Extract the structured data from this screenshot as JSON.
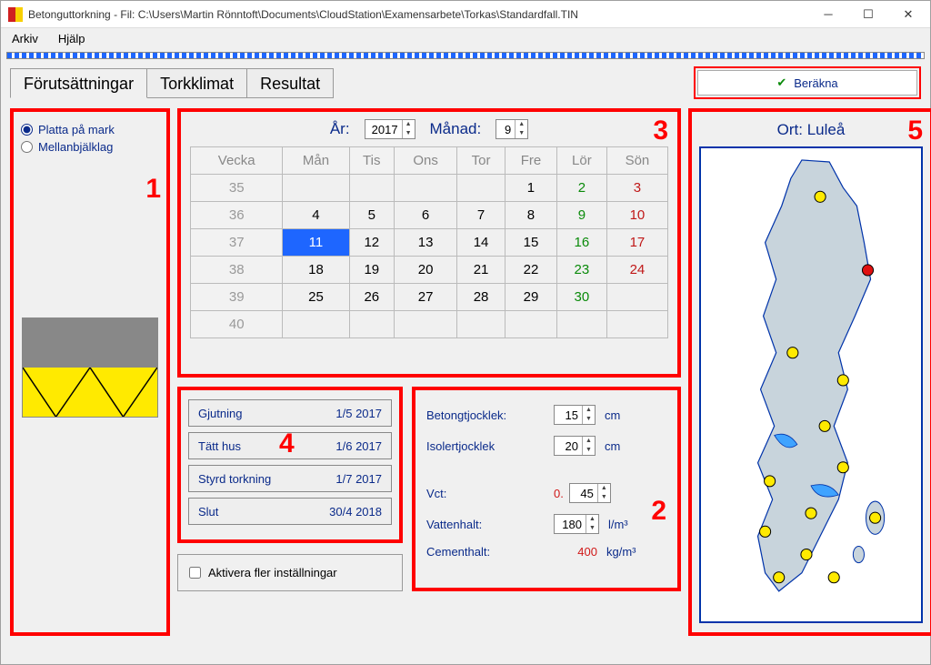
{
  "window": {
    "title": "Betonguttorkning  -  Fil: C:\\Users\\Martin Rönntoft\\Documents\\CloudStation\\Examensarbete\\Torkas\\Standardfall.TIN"
  },
  "menu": {
    "arkiv": "Arkiv",
    "hjalp": "Hjälp"
  },
  "tabs": {
    "t1": "Förutsättningar",
    "t2": "Torkklimat",
    "t3": "Resultat"
  },
  "berakna": "Beräkna",
  "annotations": {
    "n1": "1",
    "n2": "2",
    "n3": "3",
    "n4": "4",
    "n5": "5"
  },
  "sidebar": {
    "opt1": "Platta på mark",
    "opt2": "Mellanbjälklag"
  },
  "cal": {
    "year_label": "År:",
    "month_label": "Månad:",
    "year": "2017",
    "month": "9",
    "headers": {
      "vecka": "Vecka",
      "man": "Mån",
      "tis": "Tis",
      "ons": "Ons",
      "tor": "Tor",
      "fre": "Fre",
      "lor": "Lör",
      "son": "Sön"
    },
    "weeks": {
      "w35": {
        "wk": "35",
        "man": "",
        "tis": "",
        "ons": "",
        "tor": "",
        "fre": "1",
        "lor": "2",
        "son": "3"
      },
      "w36": {
        "wk": "36",
        "man": "4",
        "tis": "5",
        "ons": "6",
        "tor": "7",
        "fre": "8",
        "lor": "9",
        "son": "10"
      },
      "w37": {
        "wk": "37",
        "man": "11",
        "tis": "12",
        "ons": "13",
        "tor": "14",
        "fre": "15",
        "lor": "16",
        "son": "17"
      },
      "w38": {
        "wk": "38",
        "man": "18",
        "tis": "19",
        "ons": "20",
        "tor": "21",
        "fre": "22",
        "lor": "23",
        "son": "24"
      },
      "w39": {
        "wk": "39",
        "man": "25",
        "tis": "26",
        "ons": "27",
        "tor": "28",
        "fre": "29",
        "lor": "30",
        "son": ""
      },
      "w40": {
        "wk": "40",
        "man": "",
        "tis": "",
        "ons": "",
        "tor": "",
        "fre": "",
        "lor": "",
        "son": ""
      }
    }
  },
  "dates": {
    "gjutning": {
      "label": "Gjutning",
      "value": "1/5 2017"
    },
    "tatt": {
      "label": "Tätt hus",
      "value": "1/6 2017"
    },
    "styrd": {
      "label": "Styrd torkning",
      "value": "1/7 2017"
    },
    "slut": {
      "label": "Slut",
      "value": "30/4 2018"
    }
  },
  "activate_label": "Aktivera fler inställningar",
  "params": {
    "betong": {
      "label": "Betongtjocklek:",
      "value": "15",
      "unit": "cm"
    },
    "isoler": {
      "label": "Isolertjocklek",
      "value": "20",
      "unit": "cm"
    },
    "vct": {
      "label": "Vct:",
      "prefix": "0.",
      "value": "45",
      "unit": ""
    },
    "vatten": {
      "label": "Vattenhalt:",
      "value": "180",
      "unit": "l/m³"
    },
    "cement": {
      "label": "Cementhalt:",
      "value": "400",
      "unit": "kg/m³"
    }
  },
  "ort": {
    "label": "Ort: Luleå"
  }
}
